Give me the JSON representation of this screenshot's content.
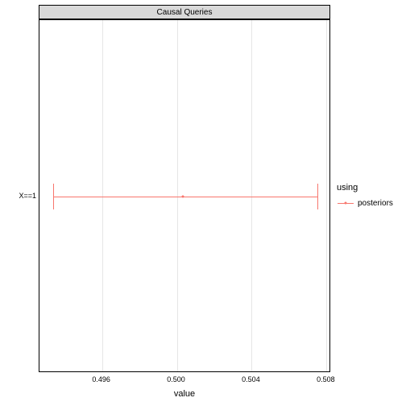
{
  "chart_data": {
    "type": "point-range",
    "title": "Causal Queries",
    "xlabel": "value",
    "ylabel": "",
    "x_ticks": [
      0.496,
      0.5,
      0.504,
      0.508
    ],
    "x_range": [
      0.4927,
      0.5082
    ],
    "y_categories": [
      "X==1"
    ],
    "series": [
      {
        "name": "posteriors",
        "color": "#f8766d",
        "points": [
          {
            "y": "X==1",
            "x": 0.5003,
            "low": 0.4934,
            "high": 0.5075
          }
        ]
      }
    ],
    "legend_title": "using"
  }
}
